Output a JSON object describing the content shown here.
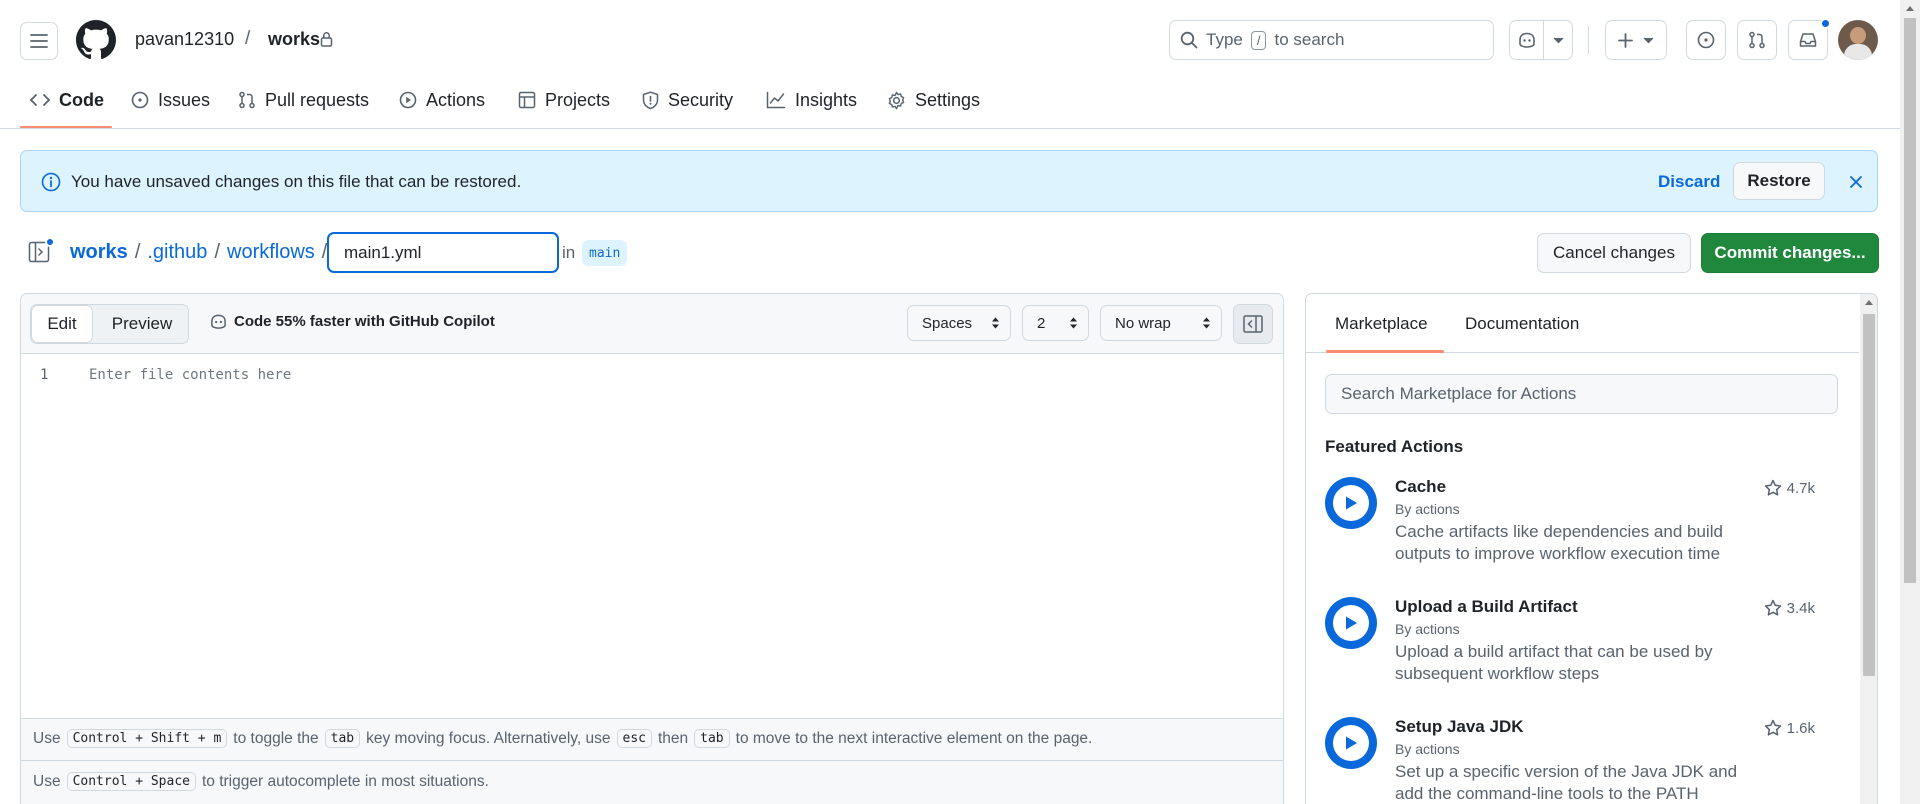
{
  "header": {
    "owner": "pavan12310",
    "separator": "/",
    "repo": "works",
    "search_hint_type": "Type",
    "search_hint_key": "/",
    "search_hint_rest": "to search"
  },
  "repo_nav": {
    "tabs": [
      {
        "label": "Code"
      },
      {
        "label": "Issues"
      },
      {
        "label": "Pull requests"
      },
      {
        "label": "Actions"
      },
      {
        "label": "Projects"
      },
      {
        "label": "Security"
      },
      {
        "label": "Insights"
      },
      {
        "label": "Settings"
      }
    ]
  },
  "banner": {
    "message": "You have unsaved changes on this file that can be restored.",
    "discard_label": "Discard",
    "restore_label": "Restore"
  },
  "breadcrumb": {
    "root": "works",
    "sep": "/",
    "dir1": ".github",
    "dir2": "workflows",
    "filename_value": "main1.yml",
    "in_label": "in",
    "branch": "main"
  },
  "actions": {
    "cancel_label": "Cancel changes",
    "commit_label": "Commit changes..."
  },
  "editor": {
    "edit_tab": "Edit",
    "preview_tab": "Preview",
    "copilot_promo": "Code 55% faster with GitHub Copilot",
    "indent_mode": "Spaces",
    "indent_size": "2",
    "wrap_mode": "No wrap",
    "line_number": "1",
    "placeholder": "Enter file contents here",
    "hint1": {
      "use": "Use",
      "key1": "Control + Shift + m",
      "t1": "to toggle the",
      "key2": "tab",
      "t2": "key moving focus. Alternatively, use",
      "key3": "esc",
      "t3": "then",
      "key4": "tab",
      "t4": "to move to the next interactive element on the page."
    },
    "hint2": {
      "use": "Use",
      "key1": "Control + Space",
      "t1": "to trigger autocomplete in most situations."
    }
  },
  "sidebar": {
    "tab_marketplace": "Marketplace",
    "tab_documentation": "Documentation",
    "search_placeholder": "Search Marketplace for Actions",
    "featured_title": "Featured Actions",
    "items": [
      {
        "name": "Cache",
        "by": "By actions",
        "desc": "Cache artifacts like dependencies and build outputs to improve workflow execution time",
        "stars": "4.7k"
      },
      {
        "name": "Upload a Build Artifact",
        "by": "By actions",
        "desc": "Upload a build artifact that can be used by subsequent workflow steps",
        "stars": "3.4k"
      },
      {
        "name": "Setup Java JDK",
        "by": "By actions",
        "desc": "Set up a specific version of the Java JDK and add the command-line tools to the PATH",
        "stars": "1.6k"
      }
    ]
  },
  "colors": {
    "accent_blue": "#0969da",
    "commit_green": "#1f883d",
    "banner_bg": "#ddf4ff",
    "active_tab_underline": "#fd8c73"
  }
}
